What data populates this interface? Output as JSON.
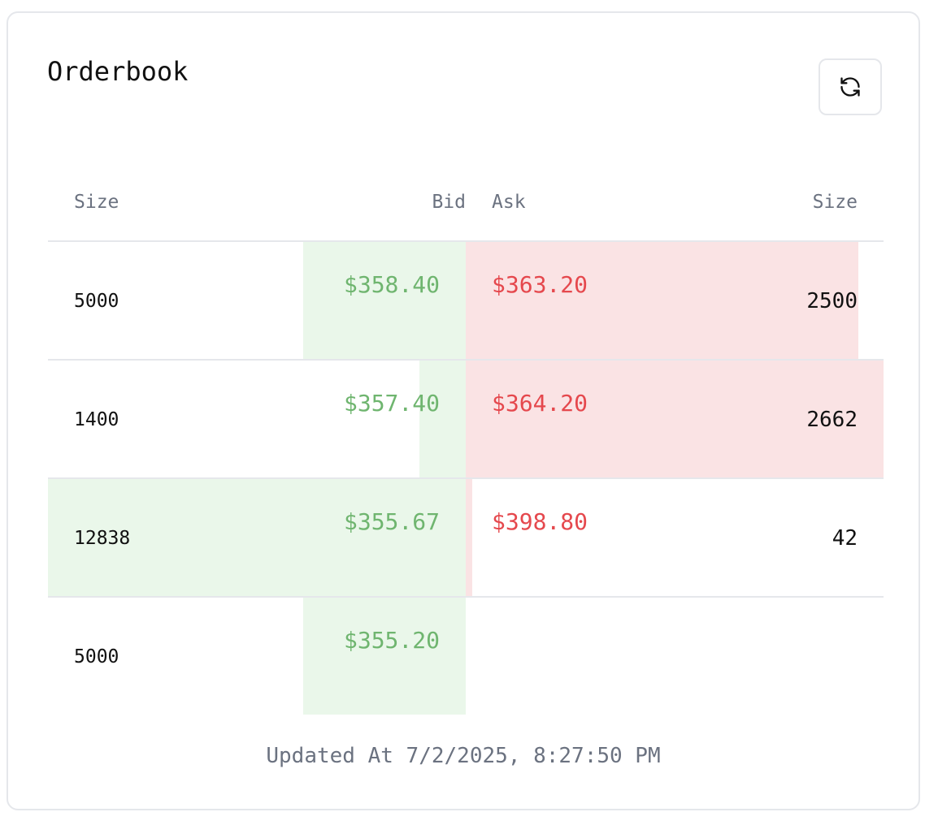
{
  "card": {
    "title": "Orderbook",
    "refresh_icon": "refresh-icon"
  },
  "columns": {
    "bid_size": "Size",
    "bid": "Bid",
    "ask": "Ask",
    "ask_size": "Size"
  },
  "rows": [
    {
      "bid_size": "5000",
      "bid": "$358.40",
      "ask": "$363.20",
      "ask_size": "2500",
      "bid_depth": 0.39,
      "ask_depth": 0.94
    },
    {
      "bid_size": "1400",
      "bid": "$357.40",
      "ask": "$364.20",
      "ask_size": "2662",
      "bid_depth": 0.11,
      "ask_depth": 1.0
    },
    {
      "bid_size": "12838",
      "bid": "$355.67",
      "ask": "$398.80",
      "ask_size": "42",
      "bid_depth": 1.0,
      "ask_depth": 0.016
    },
    {
      "bid_size": "5000",
      "bid": "$355.20",
      "ask": "",
      "ask_size": "",
      "bid_depth": 0.39,
      "ask_depth": 0
    }
  ],
  "footer": {
    "updated": "Updated At 7/2/2025, 8:27:50 PM"
  },
  "colors": {
    "bid_text": "#6fb56f",
    "ask_text": "#e5484d",
    "bid_bar": "#eaf7ea",
    "ask_bar": "#fae3e4",
    "border": "#e5e7eb",
    "muted": "#6b7280"
  }
}
